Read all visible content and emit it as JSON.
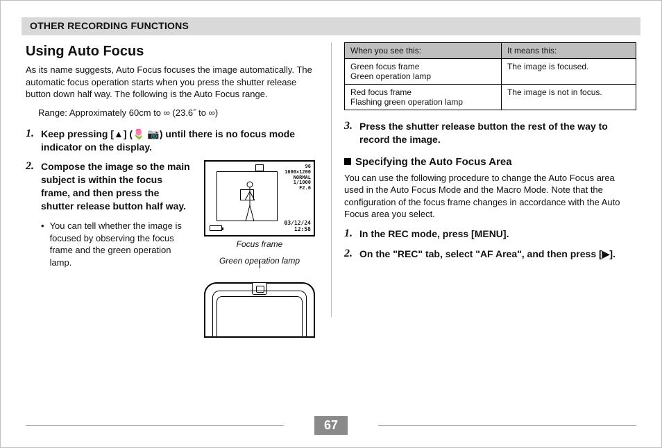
{
  "header": {
    "title": "OTHER RECORDING FUNCTIONS"
  },
  "left": {
    "heading": "Using Auto Focus",
    "intro": "As its name suggests, Auto Focus focuses the image automatically. The automatic focus operation starts when you press the shutter release button down half way. The following is the Auto Focus range.",
    "range_label": "Range: Approximately 60cm to ∞ (23.6˝ to ∞)",
    "step1_num": "1.",
    "step1_text": "Keep pressing [▲] (🌷 📷) until there is no focus mode indicator on the display.",
    "step2_num": "2.",
    "step2_text": "Compose the image so the main subject is within the focus frame, and then press the shutter release button half way.",
    "bullet": "You can tell whether the image is focused by observing the focus frame and the green operation lamp.",
    "caption_focus_frame": "Focus frame",
    "caption_lamp": "Green operation lamp",
    "viewfinder": {
      "osd_lines": "96\n1600×1200\nNORMAL\n1/1000\nF2.6",
      "date": "03/12/24\n12:58"
    }
  },
  "right": {
    "table": {
      "head_left": "When you see this:",
      "head_right": "It means this:",
      "row1_left": "Green focus frame\nGreen operation lamp",
      "row1_right": "The image is focused.",
      "row2_left": "Red focus frame\nFlashing green operation lamp",
      "row2_right": "The image is not in focus."
    },
    "step3_num": "3.",
    "step3_text": "Press the shutter release button the rest of the way to record the image.",
    "subheading": "Specifying the Auto Focus Area",
    "sub_intro": "You can use the following procedure to change the Auto Focus area used in the Auto Focus Mode and the Macro Mode. Note that the configuration of the focus frame changes in accordance with the Auto Focus area you select.",
    "sub_step1_num": "1.",
    "sub_step1_text": "In the REC mode, press [MENU].",
    "sub_step2_num": "2.",
    "sub_step2_text": "On the \"REC\" tab, select \"AF Area\", and then press [▶]."
  },
  "page_number": "67"
}
